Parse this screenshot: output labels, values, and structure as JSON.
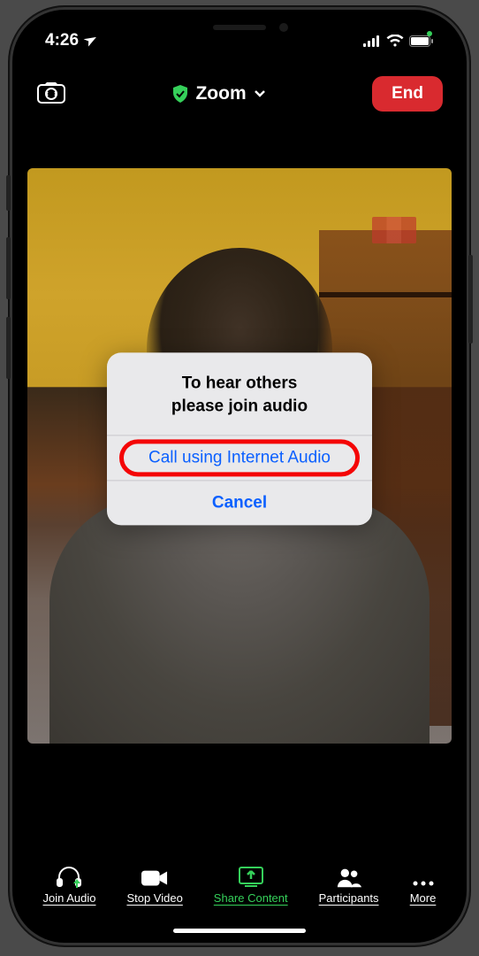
{
  "status": {
    "time": "4:26",
    "location_glyph": "➤"
  },
  "header": {
    "title": "Zoom",
    "end_label": "End"
  },
  "dialog": {
    "title_line1": "To hear others",
    "title_line2": "please join audio",
    "primary_action": "Call using Internet Audio",
    "cancel_action": "Cancel"
  },
  "bottom_bar": {
    "join_audio": "Join Audio",
    "stop_video": "Stop Video",
    "share_content": "Share Content",
    "participants": "Participants",
    "more": "More"
  }
}
